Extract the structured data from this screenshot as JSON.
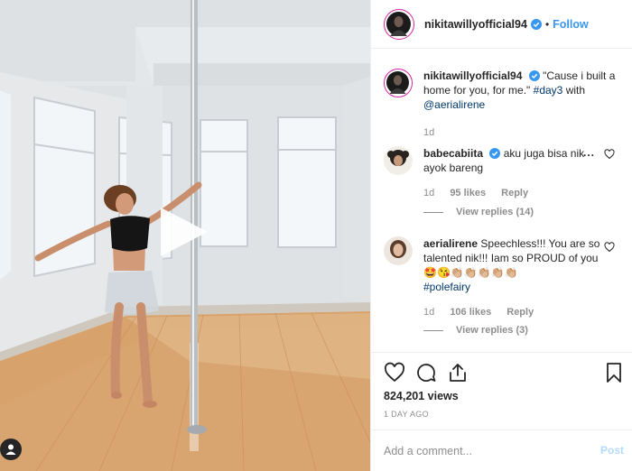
{
  "post": {
    "username": "nikitawillyofficial94",
    "follow_label": "Follow",
    "dot": "•"
  },
  "caption": {
    "username": "nikitawillyofficial94",
    "text": "\"Cause i built a home for you, for me.\"",
    "hashtag": "#day3",
    "with": "with",
    "mention": "@aerialirene",
    "time": "1d"
  },
  "comments": [
    {
      "username": "babecabiita",
      "text": "aku juga bisa nik",
      "text2": "ayok bareng",
      "time": "1d",
      "likes": "95 likes",
      "reply_label": "Reply",
      "view_replies": "View replies (14)",
      "more": "..."
    },
    {
      "username": "aerialirene",
      "text": "Speechless!!! You are so talented nik!!! Iam so PROUD of you 🤩😘👏🏼👏🏼👏🏼👏🏼👏🏼",
      "hashtag": "#polefairy",
      "time": "1d",
      "likes": "106 likes",
      "reply_label": "Reply",
      "view_replies": "View replies (3)"
    }
  ],
  "stats": {
    "views": "824,201 views",
    "ago": "1 DAY AGO"
  },
  "composer": {
    "placeholder": "Add a comment...",
    "post_label": "Post"
  },
  "colors": {
    "link": "#00376b",
    "follow": "#3897f0",
    "post_disabled": "#b3dbff",
    "muted": "#8e8e8e"
  },
  "icons": [
    "verified-badge-icon",
    "heart-icon",
    "comment-icon",
    "share-icon",
    "bookmark-icon",
    "play-icon",
    "user-tag-icon"
  ]
}
